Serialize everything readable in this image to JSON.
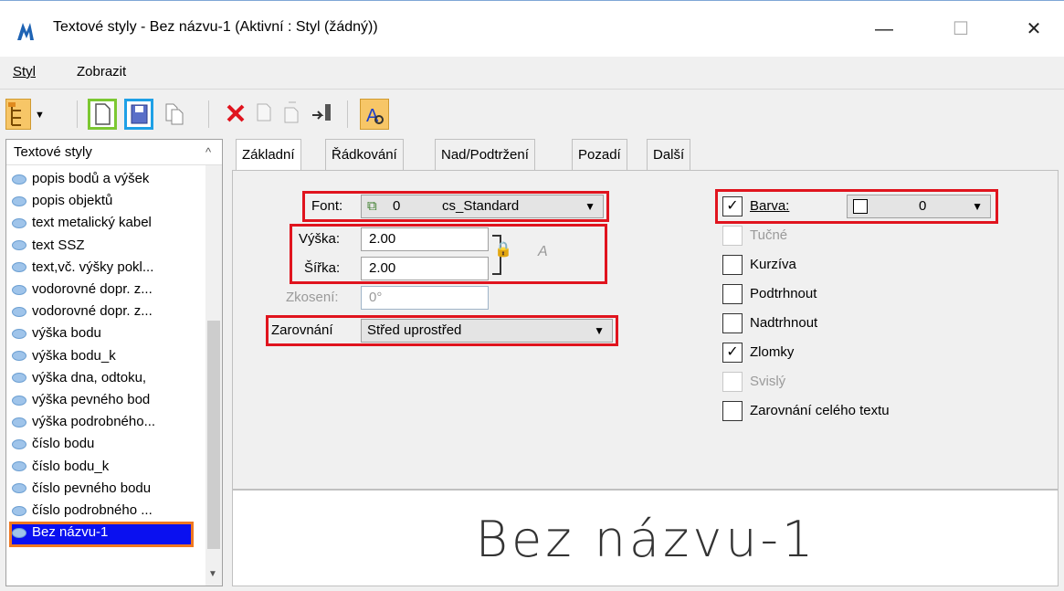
{
  "window": {
    "title": "Textové styly - Bez názvu-1 (Aktivní : Styl (žádný))",
    "minimize_glyph": "—",
    "maximize_glyph": "☐",
    "close_glyph": "✕"
  },
  "menu": {
    "items": [
      "Styl",
      "Zobrazit"
    ]
  },
  "toolbar": {
    "icons": [
      "hierarchy-icon",
      "dropdown-arrow-icon",
      "new-style-icon",
      "save-style-icon",
      "copy-style-icon",
      "delete-icon",
      "export-icon",
      "import-icon",
      "move-icon",
      "preview-toggle-icon"
    ],
    "highlight_new": "#7cc832",
    "highlight_save": "#1ea0e6"
  },
  "styles_list": {
    "header": "Textové styly",
    "sort_glyph": "^",
    "items": [
      "popis bodů a výšek",
      "popis objektů",
      "text metalický kabel",
      "text SSZ",
      "text,vč. výšky pokl...",
      "vodorovné dopr. z...",
      "vodorovné dopr. z...",
      "výška bodu",
      "výška bodu_k",
      "výška dna, odtoku,",
      "výška pevného bod",
      "výška podrobného...",
      "číslo bodu",
      "číslo bodu_k",
      "číslo pevného bodu",
      "číslo podrobného ...",
      "Bez názvu-1"
    ],
    "selected": "Bez názvu-1",
    "selected_color": "#0a10f0",
    "selected_outline": "#f07820"
  },
  "tabs": [
    "Základní",
    "Řádkování",
    "Nad/Podtržení",
    "Pozadí",
    "Další"
  ],
  "form": {
    "font_label": "Font:",
    "font_number": "0",
    "font_value": "cs_Standard",
    "height_label": "Výška:",
    "height_value": "2.00",
    "width_label": "Šířka:",
    "width_value": "2.00",
    "slant_label": "Zkosení:",
    "slant_value": "0°",
    "justification_label": "Zarovnání",
    "justification_value": "Střed uprostřed",
    "color_label": "Barva:",
    "color_value": "0",
    "color_checked": true
  },
  "checkboxes": [
    {
      "label": "Tučné",
      "checked": false,
      "disabled": true
    },
    {
      "label": "Kurzíva",
      "checked": false,
      "disabled": false
    },
    {
      "label": "Podtrhnout",
      "checked": false,
      "disabled": false
    },
    {
      "label": "Nadtrhnout",
      "checked": false,
      "disabled": false
    },
    {
      "label": "Zlomky",
      "checked": true,
      "disabled": false
    },
    {
      "label": "Svislý",
      "checked": false,
      "disabled": true
    },
    {
      "label": "Zarovnání celého textu",
      "checked": false,
      "disabled": false
    }
  ],
  "preview": {
    "text": "Bez názvu-1"
  },
  "colors": {
    "highlight_red": "#e0141e"
  }
}
